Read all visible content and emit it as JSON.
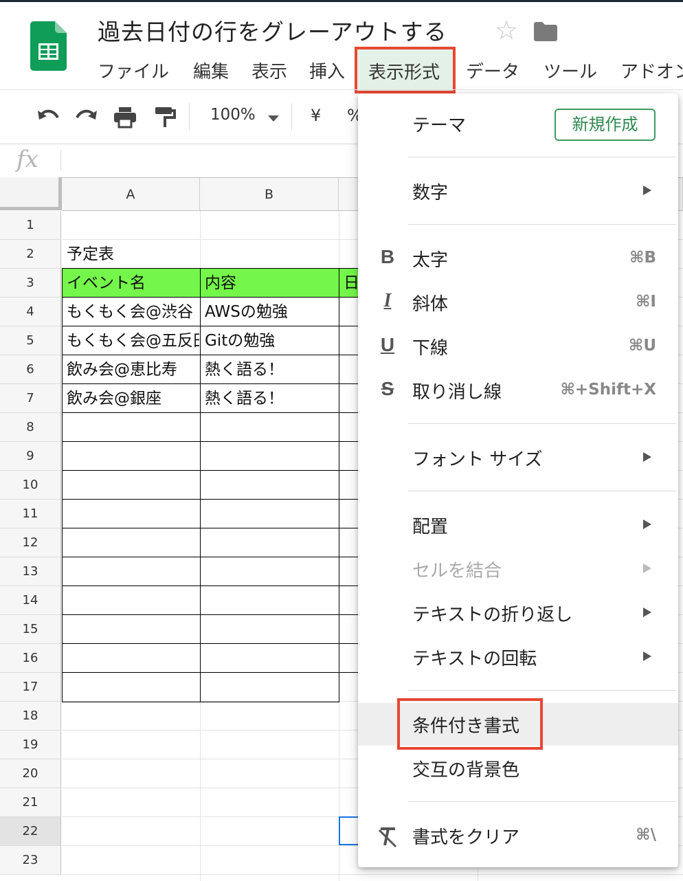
{
  "doc": {
    "title": "過去日付の行をグレーアウトする"
  },
  "menubar": {
    "items": [
      "ファイル",
      "編集",
      "表示",
      "挿入",
      "表示形式",
      "データ",
      "ツール",
      "アドオン"
    ]
  },
  "toolbar": {
    "zoom": "100%",
    "currency": "¥",
    "percent": "%"
  },
  "formula_bar": {
    "fx": "fx"
  },
  "sheet": {
    "columns": [
      "A",
      "B"
    ],
    "rows": [
      "1",
      "2",
      "3",
      "4",
      "5",
      "6",
      "7",
      "8",
      "9",
      "10",
      "11",
      "12",
      "13",
      "14",
      "15",
      "16",
      "17",
      "18",
      "19",
      "20",
      "21",
      "22",
      "23"
    ],
    "cells": {
      "a2": "予定表",
      "a3": "イベント名",
      "b3": "内容",
      "c3": "日",
      "a4": "もくもく会@渋谷",
      "b4": "AWSの勉強",
      "a5": "もくもく会@五反田",
      "b5": "Gitの勉強",
      "a6": "飲み会@恵比寿",
      "b6": "熱く語る！",
      "a7": "飲み会@銀座",
      "b7": "熱く語る！"
    },
    "header_fill_color": "#74f74a"
  },
  "format_menu": {
    "theme": "テーマ",
    "new_theme": "新規作成",
    "number": "数字",
    "bold": "太字",
    "bold_shortcut": "⌘B",
    "italic": "斜体",
    "italic_shortcut": "⌘I",
    "underline": "下線",
    "underline_shortcut": "⌘U",
    "strikethrough": "取り消し線",
    "strikethrough_shortcut": "⌘+Shift+X",
    "font_size": "フォント サイズ",
    "align": "配置",
    "merge": "セルを結合",
    "wrap": "テキストの折り返し",
    "rotate": "テキストの回転",
    "conditional": "条件付き書式",
    "alternating": "交互の背景色",
    "clear": "書式をクリア",
    "clear_shortcut": "⌘\\"
  },
  "colors": {
    "highlight_red": "#e64834",
    "sheets_green": "#0f9d58"
  }
}
